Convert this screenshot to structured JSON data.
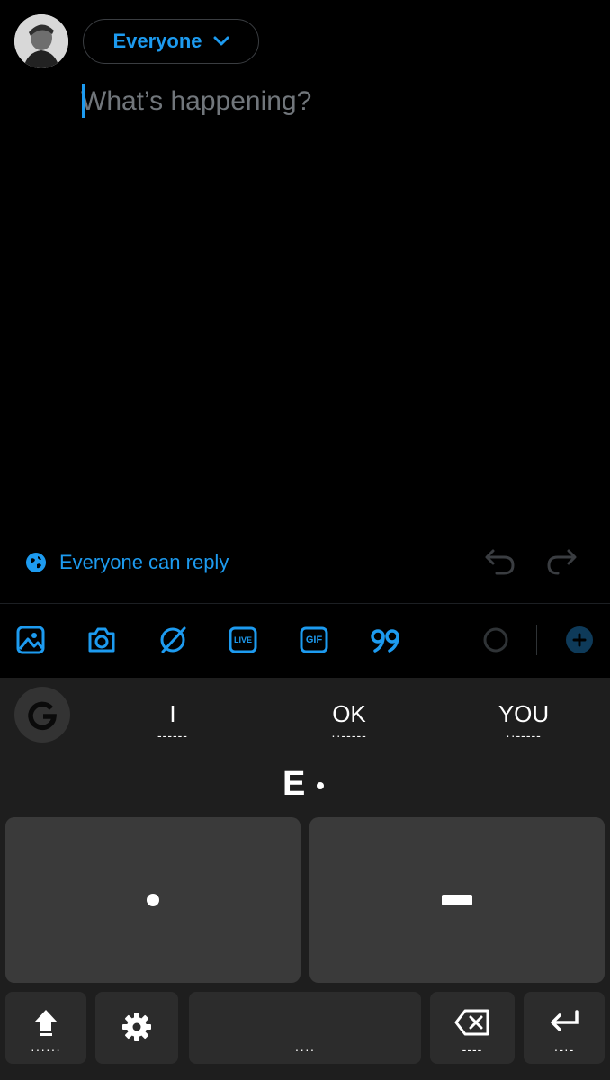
{
  "compose": {
    "audience_label": "Everyone",
    "placeholder": "What’s happening?",
    "reply_setting": "Everyone can reply"
  },
  "toolbar": {
    "icons": [
      "image-icon",
      "camera-icon",
      "sparkle-icon",
      "live-icon",
      "gif-icon",
      "quote-icon",
      "progress-circle-icon",
      "add-icon"
    ],
    "live_label": "LIVE",
    "gif_label": "GIF"
  },
  "keyboard": {
    "suggestions": [
      {
        "word": "I",
        "code": "------"
      },
      {
        "word": "OK",
        "code": "··-----"
      },
      {
        "word": "YOU",
        "code": "··-----"
      }
    ],
    "decoded_letter": "E",
    "shift_code": "······",
    "space_code": "····",
    "backspace_code": "----",
    "enter_code": "·-·-"
  },
  "colors": {
    "accent": "#1d9bf0",
    "muted": "#71767b"
  }
}
